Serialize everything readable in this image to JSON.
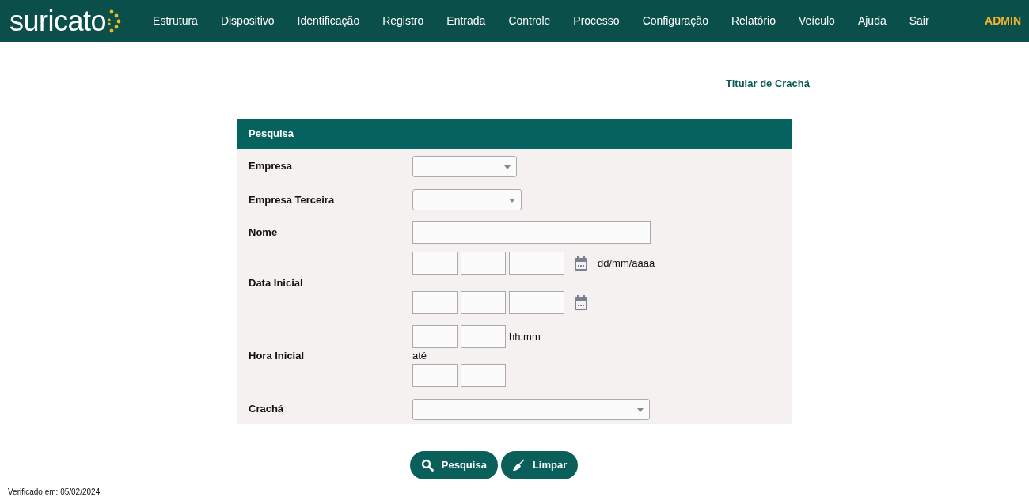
{
  "brand": {
    "name": "suricato"
  },
  "menu": [
    {
      "label": "Estrutura"
    },
    {
      "label": "Dispositivo"
    },
    {
      "label": "Identificação"
    },
    {
      "label": "Registro"
    },
    {
      "label": "Entrada"
    },
    {
      "label": "Controle"
    },
    {
      "label": "Processo"
    },
    {
      "label": "Configuração"
    },
    {
      "label": "Relatório"
    },
    {
      "label": "Veículo"
    },
    {
      "label": "Ajuda"
    },
    {
      "label": "Sair"
    }
  ],
  "user": "ADMIN",
  "page_title": "Titular de Crachá",
  "panel": {
    "title": "Pesquisa",
    "fields": [
      {
        "label": "Empresa",
        "kind": "select"
      },
      {
        "label": "Empresa Terceira",
        "kind": "select"
      },
      {
        "label": "Nome",
        "kind": "text"
      },
      {
        "label": "Data Inicial",
        "kind": "date-range",
        "hint": "dd/mm/aaaa"
      },
      {
        "label": "Hora Inicial",
        "kind": "time-range",
        "hint": "hh:mm",
        "separator": "até"
      },
      {
        "label": "Crachá",
        "kind": "select"
      }
    ]
  },
  "buttons": [
    {
      "label": "Pesquisa",
      "kind": "search"
    },
    {
      "label": "Limpar",
      "kind": "clear"
    }
  ],
  "footer": "Verificado em: 05/02/2024"
}
